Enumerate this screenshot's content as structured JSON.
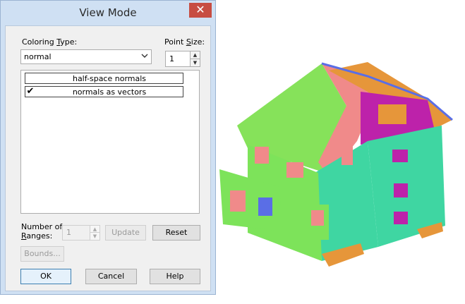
{
  "dialog": {
    "title": "View Mode",
    "close_glyph": "✕",
    "coloring_type": {
      "label_pre": "Coloring ",
      "label_u": "T",
      "label_post": "ype:",
      "value": "normal"
    },
    "point_size": {
      "label_pre": "Point ",
      "label_u": "S",
      "label_post": "ize:",
      "value": "1"
    },
    "list_items": [
      {
        "label": "half-space normals",
        "checked": false,
        "mark": ""
      },
      {
        "label": "normals as vectors",
        "checked": true,
        "mark": "✔"
      }
    ],
    "ranges": {
      "label_line1": "Number of",
      "label_line2_pre": "",
      "label_line2_u": "R",
      "label_line2_post": "anges:",
      "value": "1"
    },
    "buttons": {
      "update": "Update",
      "reset": "Reset",
      "bounds": "Bounds...",
      "ok": "OK",
      "cancel": "Cancel",
      "help": "Help"
    }
  },
  "icons": {
    "dropdown": "chevron-down-icon",
    "spin_up": "spin-up-icon",
    "spin_down": "spin-down-icon",
    "close": "close-icon",
    "check": "checkmark-icon"
  },
  "colors": {
    "title_bg": "#cfe0f3",
    "close_bg": "#c74d42",
    "normal_green": "#7de35a",
    "normal_cyan": "#3fd6a2",
    "normal_pink": "#f08a8a",
    "normal_magenta": "#b81fa8",
    "normal_orange": "#e39a3e",
    "normal_blue": "#5a6ee6"
  }
}
